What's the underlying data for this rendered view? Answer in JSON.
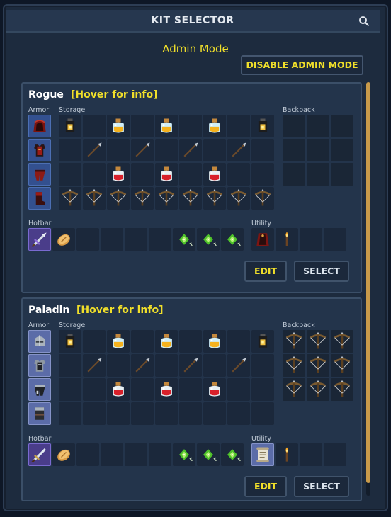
{
  "window": {
    "title": "KIT SELECTOR"
  },
  "admin": {
    "label": "Admin Mode",
    "button": "DISABLE ADMIN MODE"
  },
  "labels": {
    "armor": "Armor",
    "storage": "Storage",
    "backpack": "Backpack",
    "hotbar": "Hotbar",
    "utility": "Utility"
  },
  "buttons": {
    "edit": "EDIT",
    "select": "SELECT"
  },
  "kits": [
    {
      "name": "Rogue",
      "info": "[Hover for info]"
    },
    {
      "name": "Paladin",
      "info": "[Hover for info]"
    }
  ],
  "colors": {
    "accent_yellow": "#f0df2a",
    "panel": "#23344b",
    "frame": "#1d2b3e",
    "scrollbar": "#c89a4a"
  },
  "icons": {
    "armor_rogue": [
      "red-hood-icon",
      "red-chestplate-icon",
      "red-leggings-icon",
      "red-boots-icon"
    ],
    "armor_paladin": [
      "iron-helmet-icon",
      "iron-chestplate-icon",
      "iron-leggings-icon",
      "iron-boots-icon"
    ],
    "storage_items": [
      "lantern-icon",
      "potion-yellow-icon",
      "potion-red-icon",
      "spear-icon",
      "crossbow-icon"
    ],
    "hotbar_rogue": [
      "dagger-icon",
      "bread-icon",
      "green-gem-icon"
    ],
    "hotbar_paladin": [
      "sword-icon",
      "bread-icon",
      "green-gem-icon"
    ],
    "utility_rogue": [
      "red-cloak-icon",
      "torch-icon"
    ],
    "utility_paladin": [
      "scroll-icon",
      "torch-icon"
    ]
  }
}
